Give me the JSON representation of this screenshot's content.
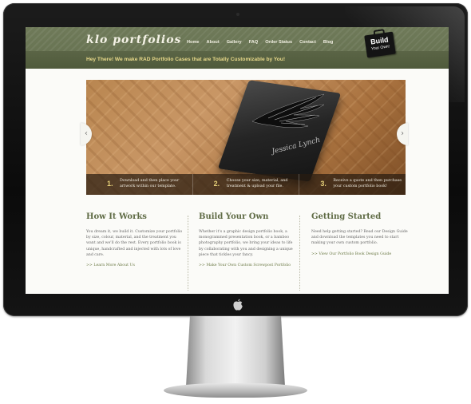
{
  "site": {
    "logo": "klo portfolios",
    "tagline": "Hey There! We make RAD Portfolio Cases that are Totally Customizable by You!",
    "nav": [
      "Home",
      "About",
      "Gallery",
      "FAQ",
      "Order Status",
      "Contact",
      "Blog"
    ],
    "badge": {
      "line1": "Build",
      "line2": "Your Own!"
    }
  },
  "slider": {
    "case_name": "Jessica Lynch",
    "prev_icon": "chevron-left-icon",
    "next_icon": "chevron-right-icon",
    "steps": [
      {
        "num": "1.",
        "text": "Download and then place your artwork within our template."
      },
      {
        "num": "2.",
        "text": "Choose your size, material, and treatment & upload your file."
      },
      {
        "num": "3.",
        "text": "Receive a quote and then purchase your custom portfolio book!"
      }
    ]
  },
  "columns": [
    {
      "heading": "How It Works",
      "body": "You dream it, we build it. Customize your portfolio by size, colour, material, and the treatment you want and we'll do the rest. Every portfolio book is unique, handcrafted and injected with lots of love and care.",
      "link": ">> Learn More About Us"
    },
    {
      "heading": "Build Your Own",
      "body": "Whether it's a graphic design portfolio book, a monogrammed presentation book, or a bamboo photography portfolio, we bring your ideas to life by collaborating with you and designing a unique piece that tickles your fancy.",
      "link": ">> Make Your Own Custom Screwpost Portfolio"
    },
    {
      "heading": "Getting Started",
      "body": "Need help getting started? Read our Design Guide and download the templates you need to start making your own custom portfolio.",
      "link": ">> View Our Portfolio Book Design Guide"
    }
  ],
  "colors": {
    "header_green": "#6f7a59",
    "tagline_yellow": "#e8d98a",
    "heading_green": "#5f6b45"
  }
}
